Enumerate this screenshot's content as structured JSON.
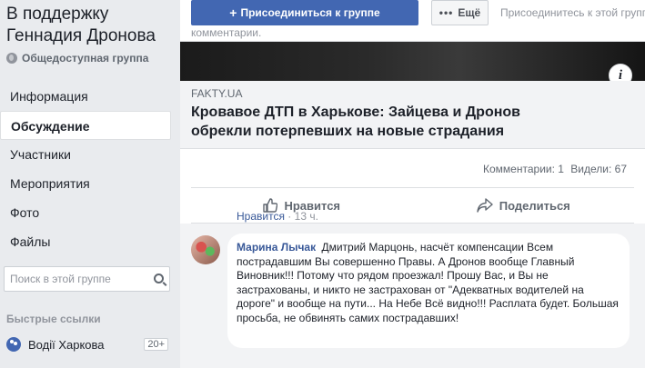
{
  "group": {
    "title": "В поддержку Геннадия Дронова",
    "type": "Общедоступная группа"
  },
  "nav": {
    "items": [
      "Информация",
      "Обсуждение",
      "Участники",
      "Мероприятия",
      "Фото",
      "Файлы"
    ],
    "active": "Обсуждение"
  },
  "search": {
    "placeholder": "Поиск в этой группе"
  },
  "quick_links": {
    "title": "Быстрые ссылки",
    "items": [
      {
        "label": "Водії Харкова",
        "badge": "20+"
      }
    ]
  },
  "top": {
    "join_label": "Присоединиться к группе",
    "more_label": "Ещё",
    "joined_text": "Присоединитесь к этой группе",
    "comments_text": "комментарии."
  },
  "post": {
    "domain": "FAKTY.UA",
    "title": "Кровавое ДТП в Харькове: Зайцева и Дронов обрекли потерпевших на новые страдания",
    "stats": {
      "comments": "Комментарии: 1",
      "views": "Видели: 67"
    },
    "actions": {
      "like": "Нравится",
      "share": "Поделиться"
    }
  },
  "comment": {
    "author": "Марина Лычак",
    "text": "Дмитрий Марцонь, насчёт компенсации Всем пострадавшим Вы совершенно Правы. А Дронов вообще Главный Виновник!!! Потому что рядом проезжал! Прошу Вас, и Вы не застрахованы, и никто не застрахован от \"Адекватных водителей на дороге\" и вообще на пути... На Небе Всё видно!!! Расплата будет. Большая просьба, не обвинять самих пострадавших!",
    "like_label": "Нравится",
    "time": "13 ч."
  }
}
